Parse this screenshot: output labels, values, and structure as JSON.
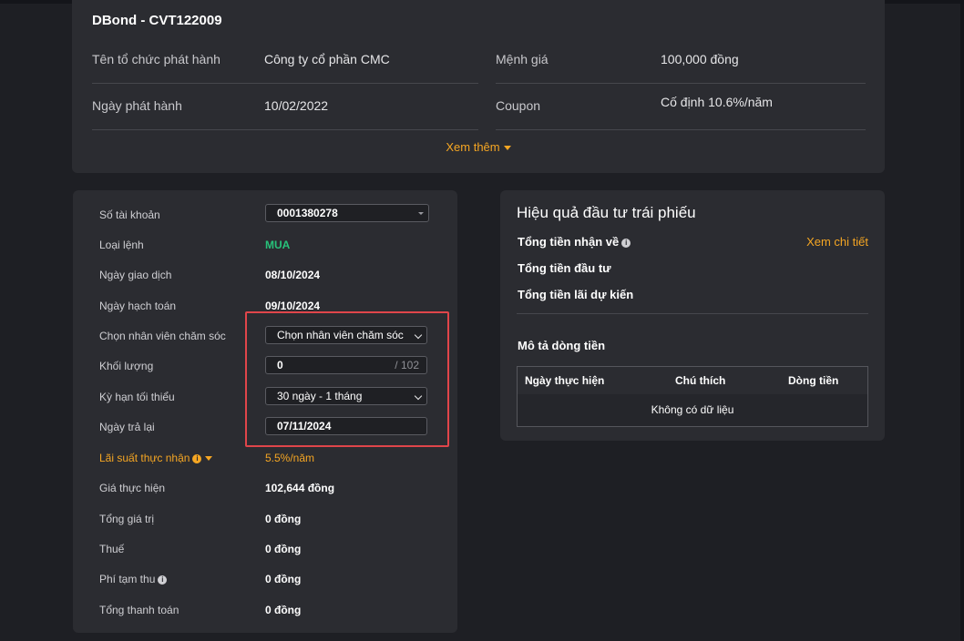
{
  "bond": {
    "title": "DBond - CVT122009",
    "issuer_label": "Tên tổ chức phát hành",
    "issuer_value": "Công ty cổ phần CMC",
    "face_value_label": "Mệnh giá",
    "face_value_value": "100,000 đồng",
    "issue_date_label": "Ngày phát hành",
    "issue_date_value": "10/02/2022",
    "coupon_label": "Coupon",
    "coupon_value": "Cố định 10.6%/năm",
    "see_more": "Xem thêm"
  },
  "form": {
    "account_label": "Số tài khoản",
    "account_value": "0001380278",
    "order_type_label": "Loại lệnh",
    "order_type_value": "MUA",
    "trade_date_label": "Ngày giao dịch",
    "trade_date_value": "08/10/2024",
    "settle_date_label": "Ngày hạch toán",
    "settle_date_value": "09/10/2024",
    "staff_label": "Chọn nhân viên chăm sóc",
    "staff_value": "Chọn nhân viên chăm sóc",
    "quantity_label": "Khối lượng",
    "quantity_value": "0",
    "quantity_max": "/ 102",
    "term_label": "Kỳ hạn tối thiểu",
    "term_value": "30 ngày - 1 tháng",
    "return_date_label": "Ngày trả lại",
    "return_date_value": "07/11/2024",
    "rate_label": "Lãi suất thực nhận",
    "rate_value": "5.5%/năm",
    "price_label": "Giá thực hiện",
    "price_value": "102,644 đồng",
    "total_value_label": "Tổng giá trị",
    "total_value_value": "0 đồng",
    "tax_label": "Thuế",
    "tax_value": "0 đồng",
    "fee_label": "Phí tạm thu",
    "fee_value": "0 đồng",
    "payment_label": "Tổng thanh toán",
    "payment_value": "0 đồng"
  },
  "performance": {
    "title": "Hiệu quả đầu tư trái phiếu",
    "received_label": "Tổng tiền nhận về",
    "detail_link": "Xem chi tiết",
    "invested_label": "Tổng tiền đầu tư",
    "interest_label": "Tổng tiền lãi dự kiến",
    "cashflow_title": "Mô tả dòng tiền",
    "columns": [
      "Ngày thực hiện",
      "Chú thích",
      "Dòng tiền"
    ],
    "empty_text": "Không có dữ liệu"
  },
  "colors": {
    "accent": "#f5a623",
    "buy": "#27c27a",
    "highlight": "#e0454a"
  }
}
